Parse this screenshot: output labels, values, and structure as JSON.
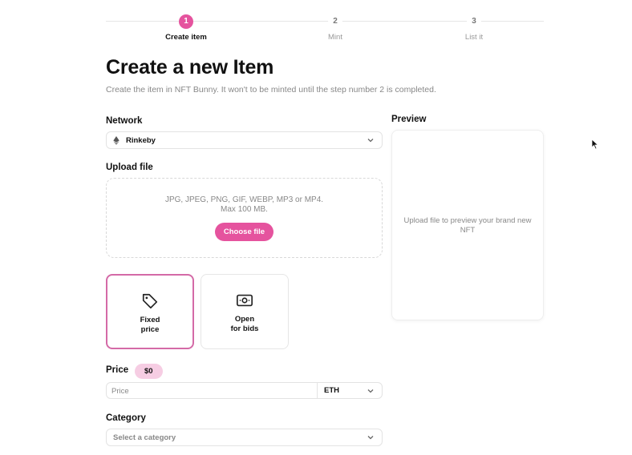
{
  "stepper": {
    "steps": [
      {
        "number": "1",
        "label": "Create item",
        "active": true
      },
      {
        "number": "2",
        "label": "Mint",
        "active": false
      },
      {
        "number": "3",
        "label": "List it",
        "active": false
      }
    ]
  },
  "page": {
    "title": "Create a new Item",
    "subtitle": "Create the item in NFT Bunny. It won't to be minted until the step number 2 is completed."
  },
  "network": {
    "label": "Network",
    "selected": "Rinkeby"
  },
  "upload": {
    "label": "Upload file",
    "formats": "JPG, JPEG, PNG, GIF, WEBP, MP3 or MP4.",
    "max_size": "Max 100 MB.",
    "button": "Choose file"
  },
  "sale_type": {
    "options": [
      {
        "line1": "Fixed",
        "line2": "price",
        "icon": "tag-icon",
        "selected": true
      },
      {
        "line1": "Open",
        "line2": "for bids",
        "icon": "banknote-icon",
        "selected": false
      }
    ]
  },
  "price": {
    "label": "Price",
    "badge": "$0",
    "placeholder": "Price",
    "currency": "ETH"
  },
  "category": {
    "label": "Category",
    "placeholder": "Select a category"
  },
  "preview": {
    "label": "Preview",
    "message": "Upload file to preview your brand new NFT"
  },
  "colors": {
    "accent": "#e5539e",
    "badge": "#f6cde3"
  }
}
